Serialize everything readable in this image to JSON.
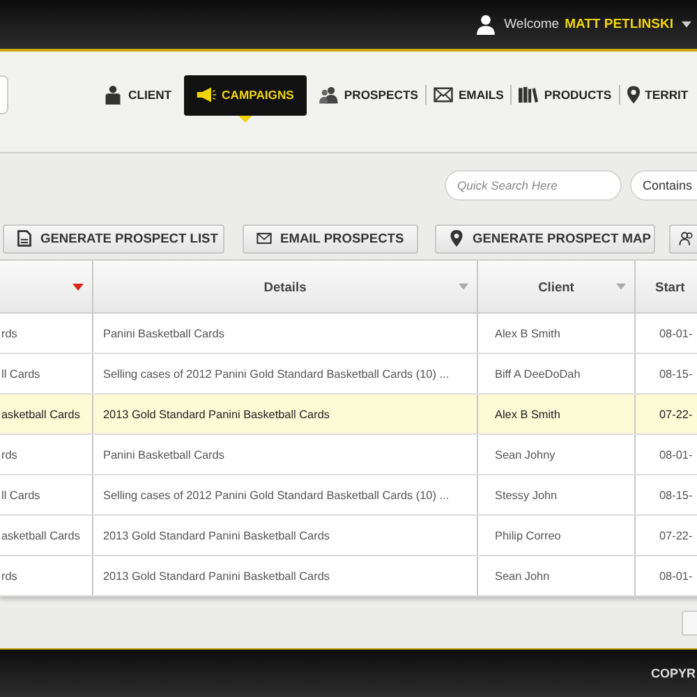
{
  "header": {
    "welcome": "Welcome",
    "user_name": "MATT PETLINSKI"
  },
  "nav": [
    {
      "label": "CLIENT",
      "selected": false
    },
    {
      "label": "CAMPAIGNS",
      "selected": true
    },
    {
      "label": "PROSPECTS",
      "selected": false
    },
    {
      "label": "EMAILS",
      "selected": false
    },
    {
      "label": "PRODUCTS",
      "selected": false
    },
    {
      "label": "TERRIT",
      "selected": false
    }
  ],
  "search": {
    "placeholder": "Quick Search Here",
    "mode": "Contains"
  },
  "toolbar": [
    {
      "kind": "labeled",
      "label": "GENERATE PROSPECT LIST"
    },
    {
      "kind": "labeled",
      "label": "EMAIL PROSPECTS"
    },
    {
      "kind": "labeled",
      "label": "GENERATE PROSPECT MAP"
    },
    {
      "kind": "icon"
    }
  ],
  "table": {
    "columns": [
      {
        "sorted": true
      },
      {
        "label": "Details",
        "sorted": false
      },
      {
        "label": "Client",
        "sorted": false
      },
      {
        "label": "Start"
      }
    ],
    "rows": [
      {
        "cells": [
          "rds",
          "Panini Basketball Cards",
          "Alex B Smith",
          "08-01-"
        ],
        "selected": false
      },
      {
        "cells": [
          "ll Cards",
          "Selling cases of 2012 Panini Gold Standard Basketball Cards (10) ...",
          "Biff A DeeDoDah",
          "08-15-"
        ],
        "selected": false
      },
      {
        "cells": [
          "asketball Cards",
          "2013 Gold Standard Panini Basketball Cards",
          "Alex B Smith",
          "07-22-"
        ],
        "selected": true
      },
      {
        "cells": [
          "rds",
          "Panini Basketball Cards",
          "Sean Johny",
          "08-01-"
        ],
        "selected": false
      },
      {
        "cells": [
          "ll Cards",
          "Selling cases of 2012 Panini Gold Standard Basketball Cards (10) ...",
          "Stessy John",
          "08-15-"
        ],
        "selected": false
      },
      {
        "cells": [
          "asketball Cards",
          "2013 Gold Standard Panini Basketball Cards",
          "Philip Correo",
          "07-22-"
        ],
        "selected": false
      },
      {
        "cells": [
          "rds",
          "2013 Gold Standard Panini Basketball Cards",
          "Sean John",
          "08-01-"
        ],
        "selected": false
      }
    ]
  },
  "footer": {
    "text": "COPYR"
  }
}
